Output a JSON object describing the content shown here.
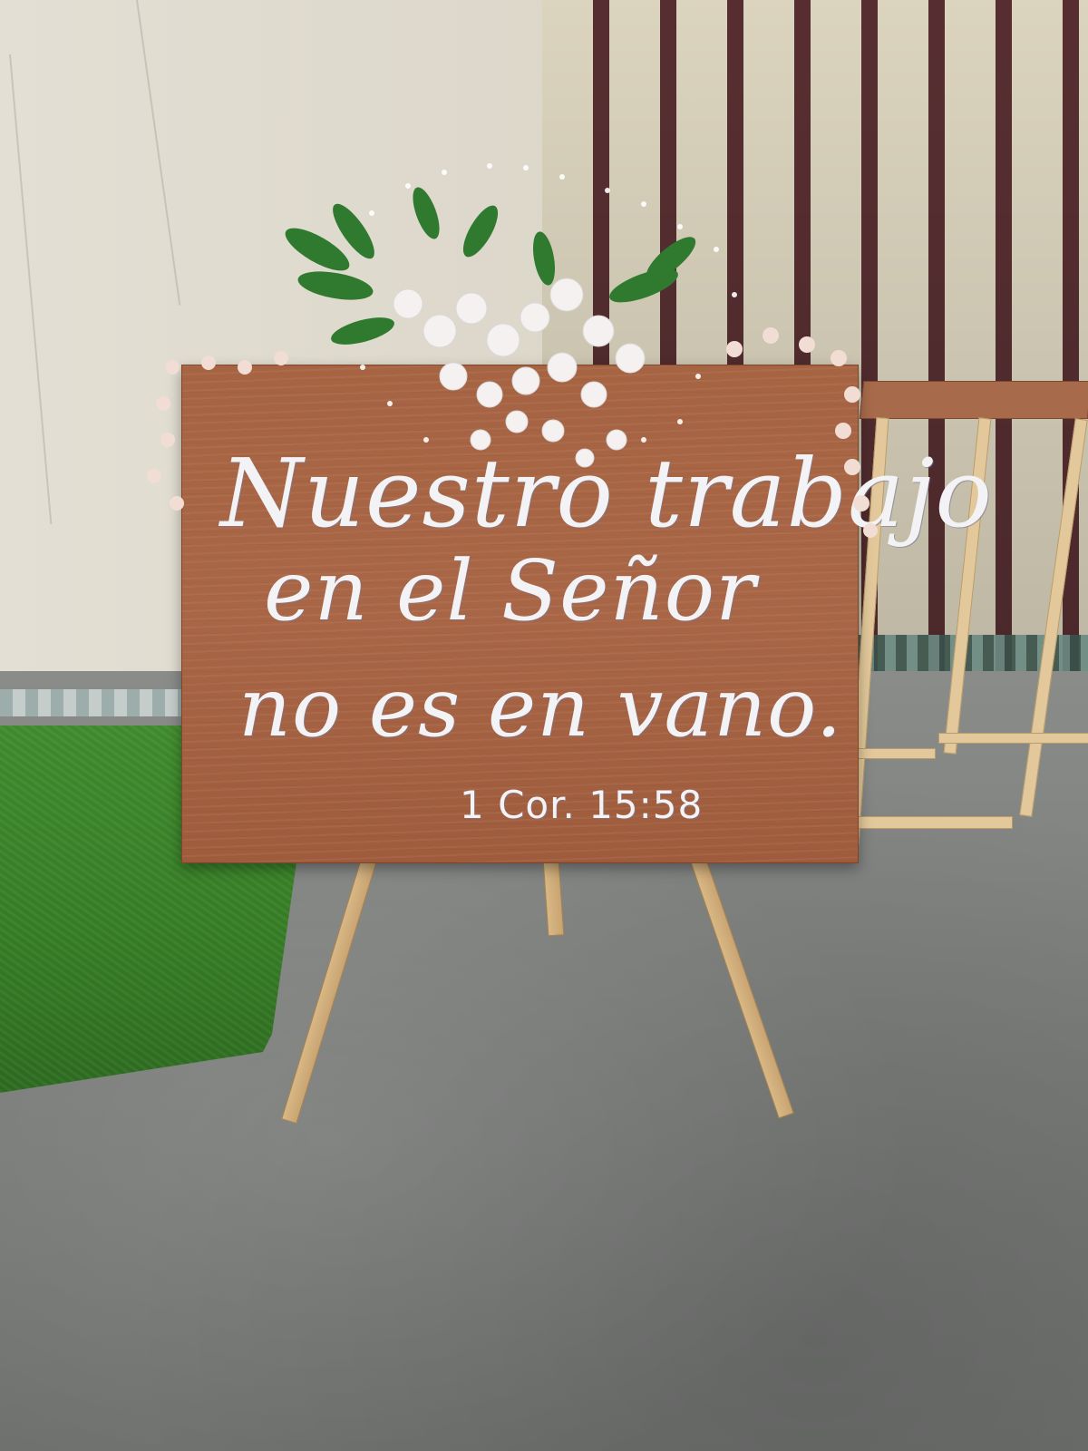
{
  "sign": {
    "line_1": "Nuestro trabajo",
    "line_2": "en el Señor",
    "line_3": "no es en vano.",
    "reference": "1 Cor. 15:58"
  },
  "colors": {
    "board": "#a76443",
    "lettering": "#f3f3f6",
    "grass": "#3f8a2c",
    "floor": "#7a7c7a",
    "slats": "#5b3134",
    "leaves": "#2f7a2e",
    "blossoms": "#f6f1f1"
  },
  "icons": [
    "flower-arrangement-icon",
    "easel-icon"
  ]
}
